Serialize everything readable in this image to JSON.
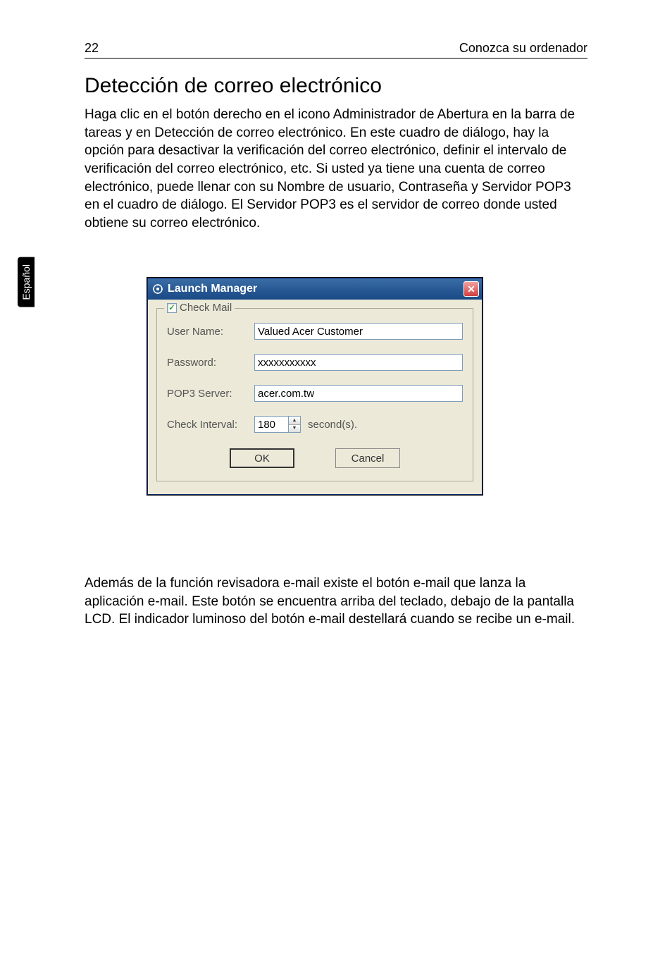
{
  "page": {
    "number": "22",
    "headerText": "Conozca su ordenador",
    "sideTab": "Español",
    "title": "Detección de correo electrónico",
    "para1": "Haga clic en el botón derecho en el icono Administrador de Abertura en la barra de tareas y en Detección de correo electrónico. En este cuadro de diálogo, hay la opción para desactivar la verificación del correo electrónico, definir el intervalo de verificación del correo electrónico, etc. Si usted ya tiene una cuenta de correo electrónico, puede llenar con su Nombre de usuario, Contraseña y Servidor POP3 en el cuadro de diálogo. El Servidor POP3 es el servidor de correo donde usted obtiene su correo electrónico.",
    "para2": "Además de la función revisadora e-mail existe el botón e-mail que lanza la aplicación e-mail. Este botón se encuentra arriba del teclado, debajo de la pantalla LCD. El indicador luminoso del botón e-mail destellará cuando se recibe un e-mail."
  },
  "dialog": {
    "title": "Launch Manager",
    "groupLegend": "Check Mail",
    "userNameLabel": "User Name:",
    "userNameValue": "Valued Acer Customer",
    "passwordLabel": "Password:",
    "passwordValue": "xxxxxxxxxxx",
    "pop3Label": "POP3 Server:",
    "pop3Value": "acer.com.tw",
    "intervalLabel": "Check Interval:",
    "intervalValue": "180",
    "secondsLabel": "second(s).",
    "okLabel": "OK",
    "cancelLabel": "Cancel"
  }
}
